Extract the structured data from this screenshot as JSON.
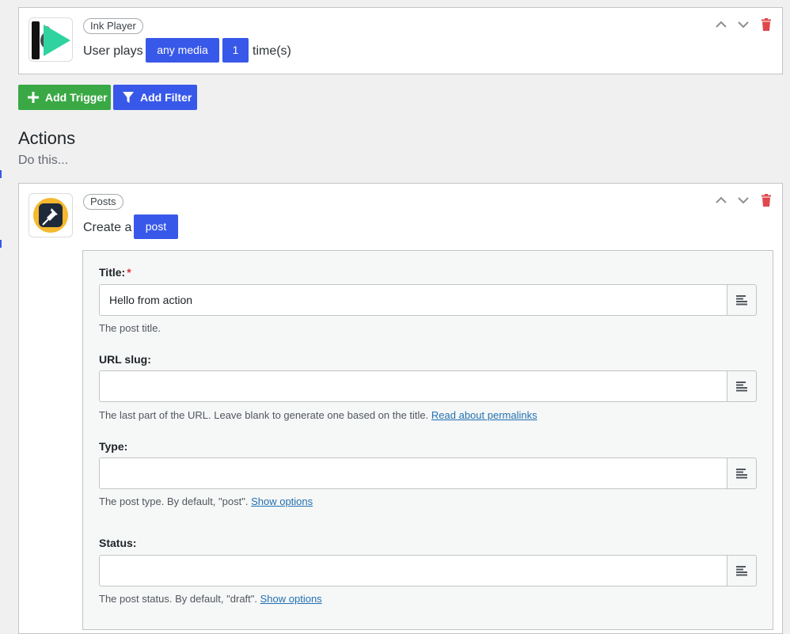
{
  "trigger": {
    "integration": "Ink Player",
    "icon": "ink-player-logo-icon",
    "sentence_prefix": "User plays",
    "token_media": "any media",
    "token_count": "1",
    "sentence_suffix": "time(s)"
  },
  "buttons": {
    "add_trigger": "Add Trigger",
    "add_filter": "Add Filter"
  },
  "actions": {
    "heading": "Actions",
    "subheading": "Do this...",
    "action": {
      "integration": "Posts",
      "icon": "pushpin-icon",
      "sentence_prefix": "Create a",
      "token": "post"
    }
  },
  "fields": {
    "title": {
      "label": "Title:",
      "required_mark": "*",
      "value": "Hello from action",
      "help": "The post title."
    },
    "slug": {
      "label": "URL slug:",
      "value": "",
      "help": "The last part of the URL. Leave blank to generate one based on the title.",
      "link": "Read about permalinks"
    },
    "type": {
      "label": "Type:",
      "value": "",
      "help": "The post type. By default, \"post\".",
      "link": "Show options"
    },
    "status": {
      "label": "Status:",
      "value": "",
      "help": "The post status. By default, \"draft\".",
      "link": "Show options"
    }
  },
  "colors": {
    "primary": "#3858e9",
    "success": "#3aa945",
    "danger": "#d63638",
    "accent_teal": "#2fd3a0",
    "accent_yellow": "#f5b82e"
  }
}
